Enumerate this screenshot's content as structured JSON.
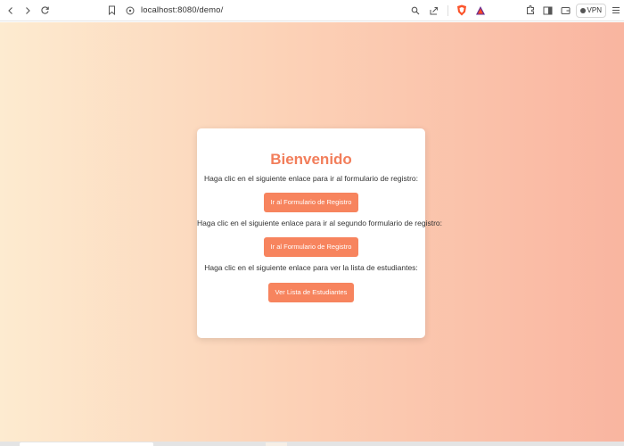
{
  "browser": {
    "url": "localhost:8080/demo/",
    "vpn_label": "VPN",
    "icons": [
      "back-icon",
      "forward-icon",
      "reload-icon",
      "bookmark-icon",
      "site-info-icon",
      "zoom-icon",
      "share-icon",
      "brave-shields-icon",
      "brave-rewards-icon",
      "extensions-icon",
      "sidebar-icon",
      "wallet-icon",
      "menu-icon"
    ]
  },
  "page": {
    "title": "Bienvenido",
    "sections": [
      {
        "text": "Haga clic en el siguiente enlace para ir al formulario de registro:",
        "button": "Ir al Formulario de Registro"
      },
      {
        "text": "Haga clic en el siguiente enlace para ir al segundo formulario de registro:",
        "button": "Ir al Formulario de Registro"
      },
      {
        "text": "Haga clic en el siguiente enlace para ver la lista de estudiantes:",
        "button": "Ver Lista de Estudiantes"
      }
    ]
  },
  "colors": {
    "accent": "#f27e5b",
    "button": "#f7845e",
    "gradient_start": "#fdebd0",
    "gradient_end": "#f9b5a0"
  }
}
